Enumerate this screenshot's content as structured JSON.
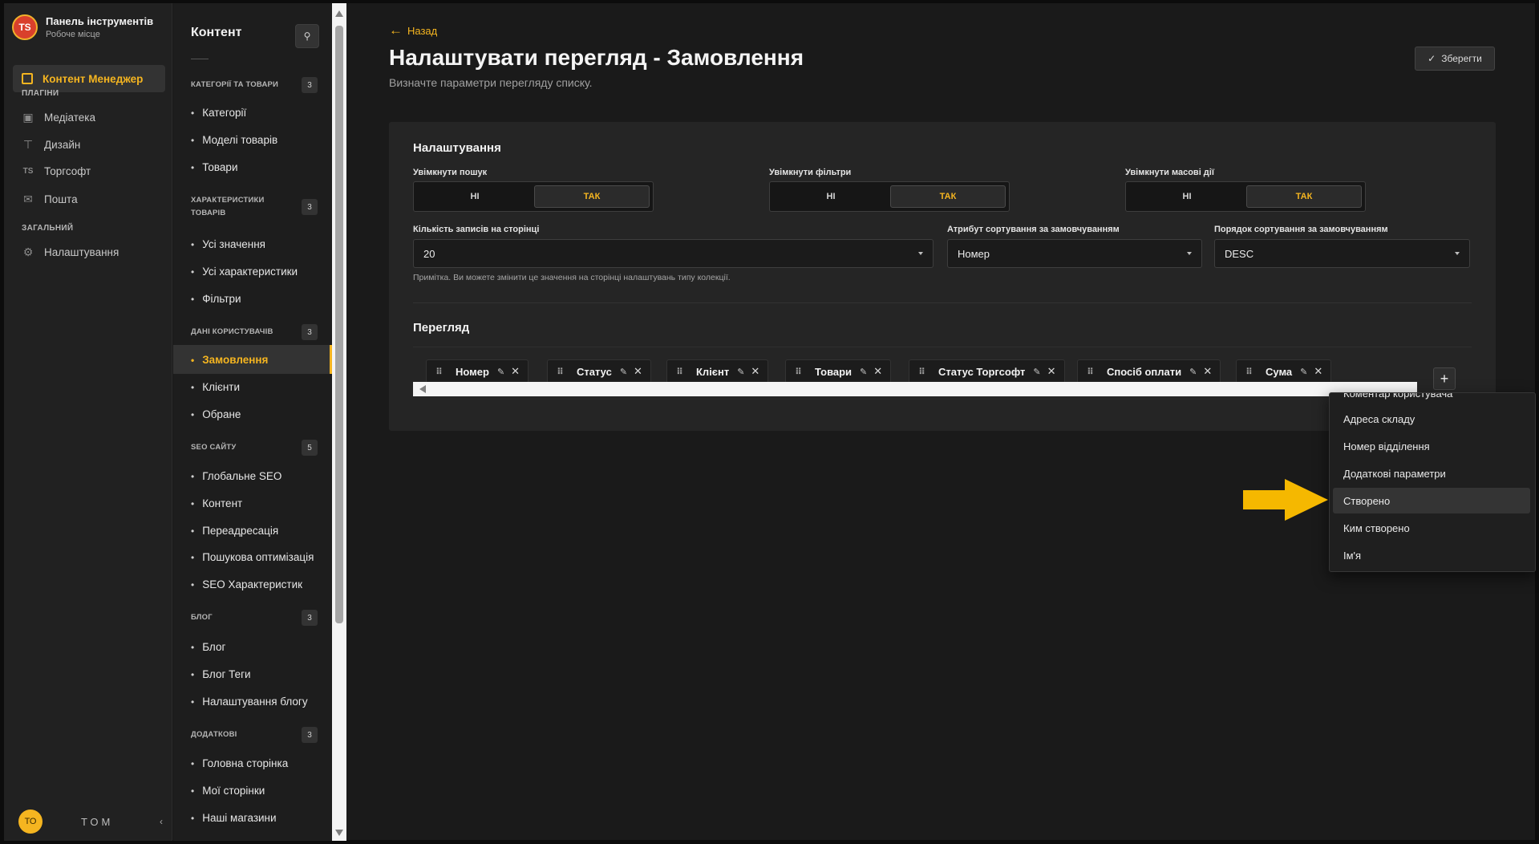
{
  "brand": {
    "logo": "TS",
    "title": "Панель інструментів",
    "subtitle": "Робоче місце"
  },
  "mainnav": {
    "active": "Контент Менеджер",
    "sections": [
      {
        "label": "ПЛАГІНИ",
        "items": [
          {
            "label": "Медіатека",
            "icon": "image-icon"
          },
          {
            "label": "Дизайн",
            "icon": "paint-roller-icon"
          },
          {
            "label": "Торгсофт",
            "icon": "ts-icon"
          },
          {
            "label": "Пошта",
            "icon": "mail-icon"
          }
        ]
      },
      {
        "label": "ЗАГАЛЬНИЙ",
        "items": [
          {
            "label": "Налаштування",
            "icon": "gear-icon"
          }
        ]
      }
    ],
    "user": {
      "initials": "ТО",
      "name": "ТОМ"
    }
  },
  "content_sidebar": {
    "title": "Контент",
    "groups": [
      {
        "label": "КАТЕГОРІЇ ТА ТОВАРИ",
        "count": "3",
        "items": [
          "Категорії",
          "Моделі товарів",
          "Товари"
        ]
      },
      {
        "label": "ХАРАКТЕРИСТИКИ ТОВАРІВ",
        "count": "3",
        "items": [
          "Усі значення",
          "Усі характеристики",
          "Фільтри"
        ]
      },
      {
        "label": "ДАНІ КОРИСТУВАЧІВ",
        "count": "3",
        "items": [
          "Замовлення",
          "Клієнти",
          "Обране"
        ]
      },
      {
        "label": "SEO САЙТУ",
        "count": "5",
        "items": [
          "Глобальне SEO",
          "Контент",
          "Переадресація",
          "Пошукова оптимізація",
          "SEO Характеристик"
        ]
      },
      {
        "label": "БЛОГ",
        "count": "3",
        "items": [
          "Блог",
          "Блог Теги",
          "Налаштування блогу"
        ]
      },
      {
        "label": "ДОДАТКОВІ",
        "count": "3",
        "items": [
          "Головна сторінка",
          "Мої сторінки",
          "Наші магазини"
        ]
      }
    ],
    "active_item": "Замовлення"
  },
  "header": {
    "back_label": "Назад",
    "title": "Налаштувати перегляд - Замовлення",
    "subtitle": "Визначте параметри перегляду списку.",
    "save_label": "Зберегти"
  },
  "settings": {
    "heading": "Налаштування",
    "toggles": [
      {
        "label": "Увімкнути пошук",
        "no": "НІ",
        "yes": "ТАК",
        "value": "ТАК"
      },
      {
        "label": "Увімкнути фільтри",
        "no": "НІ",
        "yes": "ТАК",
        "value": "ТАК"
      },
      {
        "label": "Увімкнути масові дії",
        "no": "НІ",
        "yes": "ТАК",
        "value": "ТАК"
      }
    ],
    "page_size": {
      "label": "Кількість записів на сторінці",
      "value": "20"
    },
    "sort_attr": {
      "label": "Атрибут сортування за замовчуванням",
      "value": "Номер"
    },
    "sort_order": {
      "label": "Порядок сортування за замовчуванням",
      "value": "DESC"
    },
    "note": "Примітка. Ви можете змінити це значення на сторінці налаштувань типу колекції."
  },
  "view": {
    "heading": "Перегляд",
    "columns": [
      "Номер",
      "Статус",
      "Клієнт",
      "Товари",
      "Статус Торгсофт",
      "Спосіб оплати",
      "Сума"
    ]
  },
  "dropdown": {
    "items": [
      "Коментар користувача",
      "Адреса складу",
      "Номер відділення",
      "Додаткові параметри",
      "Створено",
      "Ким створено",
      "Ім'я"
    ],
    "highlighted": "Створено"
  },
  "colors": {
    "accent": "#f5b520",
    "background": "#1a1a1a",
    "card": "#252525",
    "pointer": "#f5b800"
  }
}
